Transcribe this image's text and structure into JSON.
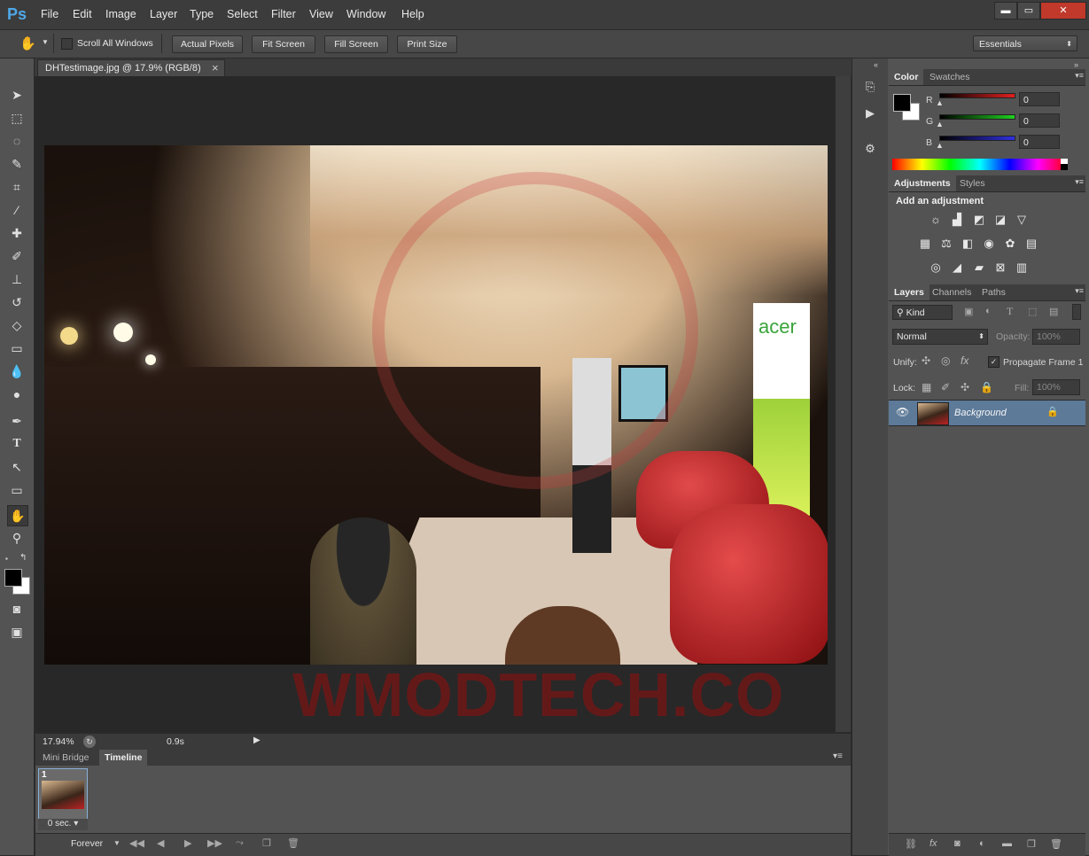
{
  "app": {
    "logo": "Ps"
  },
  "menu": [
    "File",
    "Edit",
    "Image",
    "Layer",
    "Type",
    "Select",
    "Filter",
    "View",
    "Window",
    "Help"
  ],
  "window_controls": {
    "minimize": "▬",
    "maximize": "▭",
    "close": "✕"
  },
  "options_bar": {
    "scroll_all_windows": "Scroll All Windows",
    "actual_pixels": "Actual Pixels",
    "fit_screen": "Fit Screen",
    "fill_screen": "Fill Screen",
    "print_size": "Print Size",
    "workspace": "Essentials"
  },
  "document": {
    "tab_title": "DHTestimage.jpg @ 17.9% (RGB/8)",
    "close": "×",
    "watermark_text": "WMODTECH.COM",
    "photo_sign": "acer"
  },
  "status_bar": {
    "zoom": "17.94%",
    "time": "0.9s"
  },
  "timeline_panel": {
    "tabs": [
      "Mini Bridge",
      "Timeline"
    ],
    "frame_number": "1",
    "frame_delay": "0 sec.",
    "loop": "Forever"
  },
  "color_panel": {
    "tabs": [
      "Color",
      "Swatches"
    ],
    "channels": [
      {
        "label": "R",
        "value": "0",
        "color": "#d02020"
      },
      {
        "label": "G",
        "value": "0",
        "color": "#20c020"
      },
      {
        "label": "B",
        "value": "0",
        "color": "#3030d0"
      }
    ]
  },
  "adjustments_panel": {
    "tabs": [
      "Adjustments",
      "Styles"
    ],
    "heading": "Add an adjustment",
    "icons": [
      "brightness-icon",
      "levels-icon",
      "curves-icon",
      "exposure-icon",
      "vibrance-icon",
      "hue-sat-icon",
      "color-balance-icon",
      "black-white-icon",
      "photo-filter-icon",
      "channel-mixer-icon",
      "color-lookup-icon",
      "invert-icon",
      "posterize-icon",
      "threshold-icon",
      "gradient-map-icon",
      "selective-color-icon"
    ]
  },
  "layers_panel": {
    "tabs": [
      "Layers",
      "Channels",
      "Paths"
    ],
    "filter_kind": "Kind",
    "blend_mode": "Normal",
    "opacity_label": "Opacity:",
    "opacity_value": "100%",
    "unify_label": "Unify:",
    "propagate_label": "Propagate Frame 1",
    "lock_label": "Lock:",
    "fill_label": "Fill:",
    "fill_value": "100%",
    "layers": [
      {
        "name": "Background",
        "visible": true,
        "locked": true
      }
    ]
  }
}
